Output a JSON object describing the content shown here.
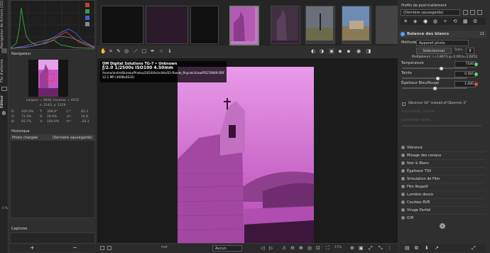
{
  "vertical_tabs": [
    "Navigateur de fichiers (22)",
    "File d'attente",
    "Éditeur"
  ],
  "left_panel": {
    "navigator_title": "Navigateur",
    "dimensions": "Largeur = 3008, Hauteur = 4032",
    "coordinates": "x: 2143, y: 2329",
    "readouts": [
      [
        "R:",
        "100.0%",
        "T:",
        "308.9°",
        "L*:",
        "62.3"
      ],
      [
        "V:",
        "71.0%",
        "S:",
        "29.0%",
        "a*:",
        "54.8"
      ],
      [
        "B:",
        "93.7%",
        "V:",
        "100.0%",
        "b*:",
        "-20.3"
      ]
    ],
    "history_title": "Historique",
    "history_items": [
      "Photo chargée",
      "(Dernière sauvegarde)"
    ],
    "snapshots_title": "Captures",
    "snapshots_add": "+",
    "snapshots_remove": "−",
    "zoom_label": "0 %"
  },
  "overlay": {
    "line1": "OM Digital Solutions TG-7 • Unknown",
    "line2": "ƒ/2.0  1/2500s  ISO100  4.50mm",
    "line3": "/home/andre/Bureau/Photos/2024/Activités/03-Rando_Puycelci/raw/P3170049.ORF",
    "line4": "12.1 MP (3008x4032)"
  },
  "bottom_bar": {
    "left_label": "Préf.",
    "select_label": "Aucun",
    "zoom": "17%"
  },
  "right_panel": {
    "profile_title": "Profils de post-traitement",
    "profile_value": "(Dernière sauvegarde)",
    "section_title": "Balance des blancs",
    "section_index": "11",
    "method_label": "Méthode",
    "method_value": "Appareil photo",
    "picker_button": "Sélectionner",
    "picker_size_label": "Taille",
    "picker_size_value": "8",
    "multipliers": "Multiplieurs: r=1.8673 g=1.00 b=1.6251",
    "sliders": [
      {
        "label": "Température",
        "value": "7100",
        "pos": 0.6
      },
      {
        "label": "Teinte",
        "value": "0.565",
        "pos": 0.55
      },
      {
        "label": "Égaliseur Bleu/Rouge",
        "value": "1.000",
        "pos": 0.5
      }
    ],
    "observer_label": "Observer 10° instead of Observer 2°",
    "disabled_rows": [
      "Auto temp. / correl. ...",
      "Correction après ...",
      "...",
      "..."
    ],
    "tools": [
      "Vibrance",
      "Mixage des canaux",
      "Noir & Blanc",
      "Égaliseur TSV",
      "Simulation de Film",
      "Film Negatif",
      "Lumière douce",
      "Courbes RVB",
      "Virage Partiel",
      "ICM"
    ],
    "colors": {
      "accent": "#4aa3ff",
      "green": "#6ad06a",
      "red": "#e05050"
    }
  }
}
